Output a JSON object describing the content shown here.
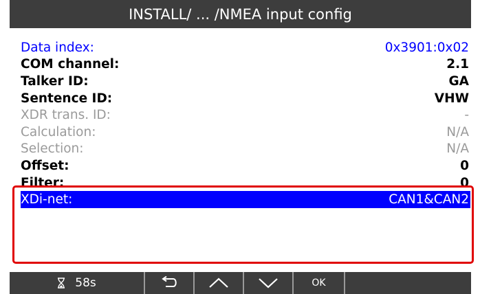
{
  "header": {
    "title": "INSTALL/ ... /NMEA input config"
  },
  "rows": [
    {
      "label": "Data index:",
      "value": "0x3901:0x02"
    },
    {
      "label": "COM channel:",
      "value": "2.1"
    },
    {
      "label": "Talker ID:",
      "value": "GA"
    },
    {
      "label": "Sentence ID:",
      "value": "VHW"
    },
    {
      "label": "XDR trans. ID:",
      "value": "-"
    },
    {
      "label": "Calculation:",
      "value": "N/A"
    },
    {
      "label": "Selection:",
      "value": "N/A"
    },
    {
      "label": "Offset:",
      "value": "0"
    },
    {
      "label": "Filter:",
      "value": "0"
    },
    {
      "label": "XDi-net:",
      "value": "CAN1&CAN2"
    }
  ],
  "footer": {
    "timer_icon": "hourglass-icon",
    "timer": "58s",
    "back_icon": "back-arrow-icon",
    "up_icon": "chevron-up-icon",
    "down_icon": "chevron-down-icon",
    "ok_label": "OK"
  },
  "colors": {
    "bar": "#3d3d3d",
    "highlight": "#0000ff",
    "frame": "#e00000",
    "disabled": "#9a9a9a"
  }
}
